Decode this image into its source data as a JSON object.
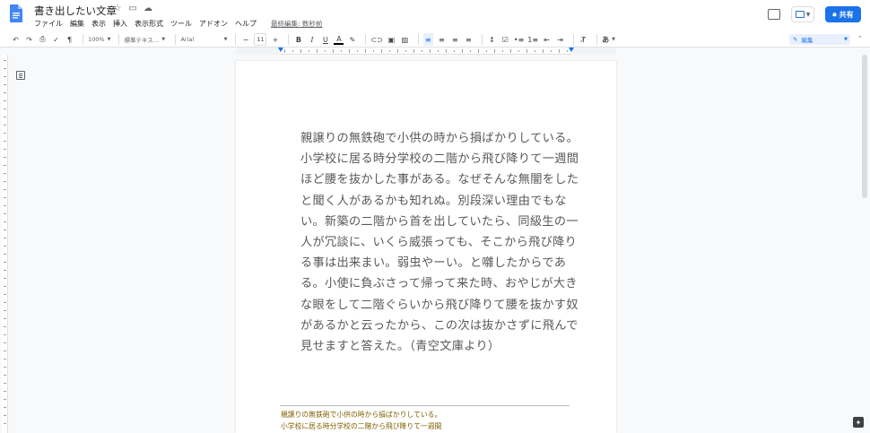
{
  "document": {
    "title": "書き出したい文章",
    "last_edit": "最終編集: 数秒前"
  },
  "menu": [
    "ファイル",
    "編集",
    "表示",
    "挿入",
    "表示形式",
    "ツール",
    "アドオン",
    "ヘルプ"
  ],
  "header_actions": {
    "share_label": "共有"
  },
  "toolbar": {
    "zoom": "100%",
    "style": "標準テキス…",
    "font": "Arial",
    "font_size": "11",
    "bold": "B",
    "italic": "I",
    "underline": "U",
    "text_color": "A",
    "input_tools": "あ",
    "mode": "編集"
  },
  "body_lines": [
    "親譲りの無鉄砲で小供の時から損ばかりしている。",
    "小学校に居る時分学校の二階から飛び降りて一週間",
    "ほど腰を抜かした事がある。なぜそんな無闇をした",
    "と聞く人があるかも知れぬ。別段深い理由でもな",
    "い。新築の二階から首を出していたら、同級生の一",
    "人が冗談に、いくら威張っても、そこから飛び降り",
    "る事は出来まい。弱虫やーい。と囃したからであ",
    "る。小使に負ぶさって帰って来た時、おやじが大き",
    "な眼をして二階ぐらいから飛び降りて腰を抜かす奴",
    "があるかと云ったから、この次は抜かさずに飛んで",
    "見せますと答えた。（青空文庫より）"
  ],
  "footnote_lines": [
    "親譲りの無鉄砲で小供の時から損ばかりしている。",
    "小学校に居る時分学校の二階から飛び降りて一週間"
  ],
  "colors": {
    "accent": "#1a73e8",
    "body_text": "#595959",
    "footnote_text": "#7f6000"
  }
}
